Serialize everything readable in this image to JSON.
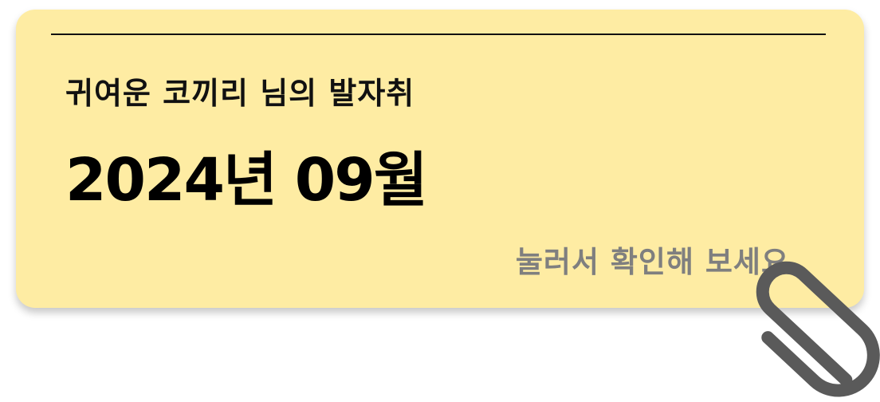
{
  "card": {
    "subtitle": "귀여운 코끼리 님의 발자취",
    "title": "2024년 09월",
    "hint": "눌러서 확인해 보세요"
  },
  "icons": {
    "clip": "paperclip-icon"
  },
  "colors": {
    "card_background": "#feeca3",
    "title_text": "#000000",
    "hint_text": "#7f7f7f",
    "clip": "#5a5a5a"
  }
}
